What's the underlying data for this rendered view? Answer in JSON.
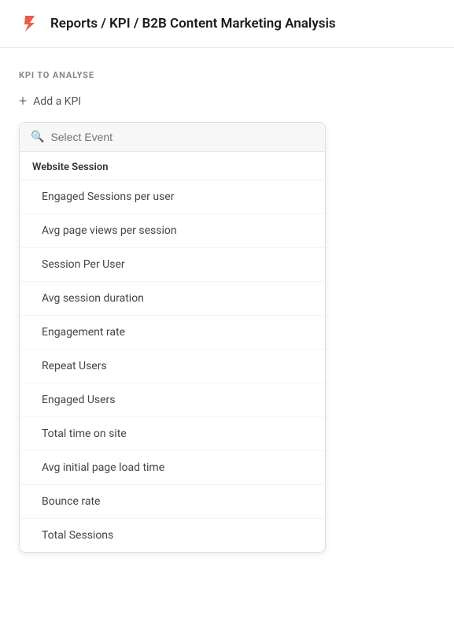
{
  "header": {
    "breadcrumb": "Reports / KPI / B2B Content Marketing Analysis",
    "logo_color": "#e85d4a"
  },
  "section": {
    "label": "KPI TO ANALYSE",
    "add_kpi_label": "Add a KPI"
  },
  "search": {
    "placeholder": "Select Event"
  },
  "group": {
    "label": "Website Session"
  },
  "menu_items": [
    {
      "id": 1,
      "label": "Engaged Sessions per user"
    },
    {
      "id": 2,
      "label": "Avg page views per session"
    },
    {
      "id": 3,
      "label": "Session Per User"
    },
    {
      "id": 4,
      "label": "Avg session duration"
    },
    {
      "id": 5,
      "label": "Engagement rate"
    },
    {
      "id": 6,
      "label": "Repeat Users"
    },
    {
      "id": 7,
      "label": "Engaged Users"
    },
    {
      "id": 8,
      "label": "Total time on site"
    },
    {
      "id": 9,
      "label": "Avg initial page load time"
    },
    {
      "id": 10,
      "label": "Bounce rate"
    },
    {
      "id": 11,
      "label": "Total Sessions"
    }
  ]
}
